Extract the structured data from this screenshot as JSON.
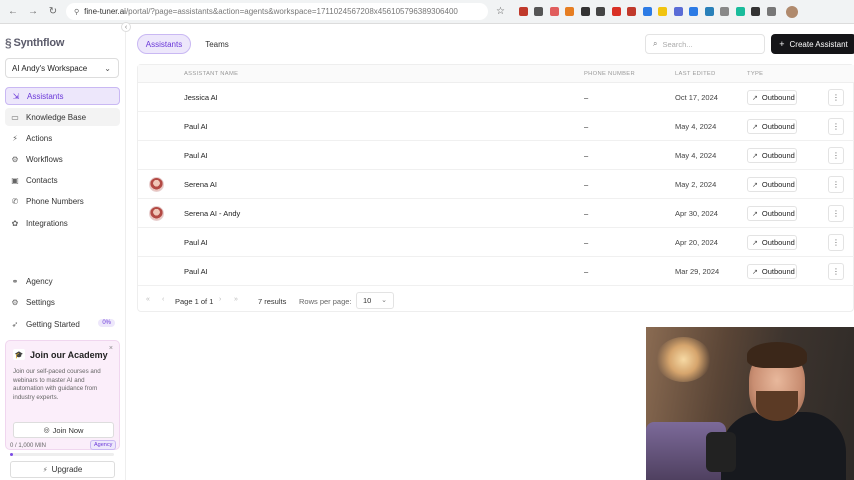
{
  "browser": {
    "url_host": "fine-tuner.ai",
    "url_path": "/portal/?page=assistants&action=agents&workspace=1711024567208x456105796389306400",
    "extension_colors": [
      "#c0392b",
      "#555",
      "#e05d5d",
      "#e67e22",
      "#333",
      "#444",
      "#d93025",
      "#c0392b",
      "#2c7be5",
      "#f1c40f",
      "#5a6cd6",
      "#2c7be5",
      "#2980b9",
      "#888",
      "#1abc9c",
      "#333",
      "#777"
    ]
  },
  "sidebar": {
    "logo": "Synthflow",
    "workspace": "AI Andy's Workspace",
    "nav": [
      {
        "label": "Assistants",
        "icon": "assistant-icon",
        "glyph": "⇲"
      },
      {
        "label": "Knowledge Base",
        "icon": "book-icon",
        "glyph": "▭"
      },
      {
        "label": "Actions",
        "icon": "lightning-icon",
        "glyph": "⚡"
      },
      {
        "label": "Workflows",
        "icon": "workflow-icon",
        "glyph": "⚙"
      },
      {
        "label": "Contacts",
        "icon": "contacts-icon",
        "glyph": "▣"
      },
      {
        "label": "Phone Numbers",
        "icon": "phone-icon",
        "glyph": "✆"
      },
      {
        "label": "Integrations",
        "icon": "puzzle-icon",
        "glyph": "✿"
      }
    ],
    "bottom_nav": [
      {
        "label": "Agency",
        "icon": "agency-icon",
        "glyph": "⚭"
      },
      {
        "label": "Settings",
        "icon": "gear-icon",
        "glyph": "⚙"
      },
      {
        "label": "Getting Started",
        "icon": "rocket-icon",
        "glyph": "➶",
        "badge": "0%"
      }
    ],
    "academy": {
      "title": "Join our Academy",
      "text": "Join our self-paced courses and webinars to master AI and automation with guidance from industry experts.",
      "button": "Join Now"
    },
    "usage": {
      "label": "0 / 1,000 MIN",
      "badge": "Agency",
      "fraction": 0.03
    },
    "upgrade": "Upgrade"
  },
  "main": {
    "tabs": [
      "Assistants",
      "Teams"
    ],
    "search_placeholder": "Search...",
    "create_button": "Create Assistant",
    "columns": {
      "name": "Assistant Name",
      "phone": "Phone Number",
      "edited": "Last Edited",
      "type": "Type"
    },
    "rows": [
      {
        "name": "Jessica AI",
        "phone": "–",
        "edited": "Oct 17, 2024",
        "type": "Outbound",
        "avatar": false
      },
      {
        "name": "Paul AI",
        "phone": "–",
        "edited": "May 4, 2024",
        "type": "Outbound",
        "avatar": false
      },
      {
        "name": "Paul AI",
        "phone": "–",
        "edited": "May 4, 2024",
        "type": "Outbound",
        "avatar": false
      },
      {
        "name": "Serena AI",
        "phone": "–",
        "edited": "May 2, 2024",
        "type": "Outbound",
        "avatar": true
      },
      {
        "name": "Serena AI - Andy",
        "phone": "–",
        "edited": "Apr 30, 2024",
        "type": "Outbound",
        "avatar": true
      },
      {
        "name": "Paul AI",
        "phone": "–",
        "edited": "Apr 20, 2024",
        "type": "Outbound",
        "avatar": false
      },
      {
        "name": "Paul AI",
        "phone": "–",
        "edited": "Mar 29, 2024",
        "type": "Outbound",
        "avatar": false
      }
    ],
    "pager": {
      "page_label": "Page 1 of 1",
      "results": "7 results",
      "rows_per_page_label": "Rows per page:",
      "rows_per_page": "10"
    }
  }
}
